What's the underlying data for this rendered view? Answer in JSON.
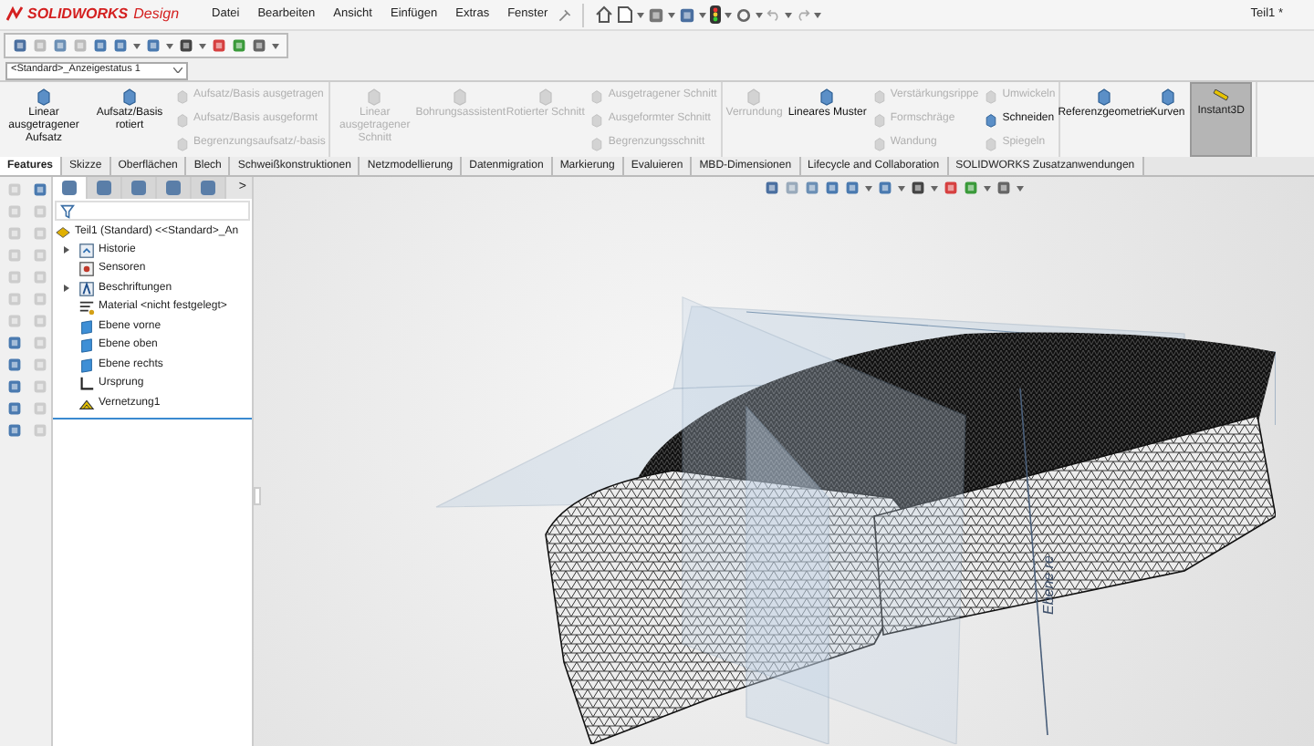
{
  "title_bar": {
    "brand": "SOLIDWORKS",
    "product": "Design",
    "menu": [
      {
        "label": "Datei"
      },
      {
        "label": "Bearbeiten"
      },
      {
        "label": "Ansicht"
      },
      {
        "label": "Einfügen"
      },
      {
        "label": "Extras"
      },
      {
        "label": "Fenster"
      }
    ],
    "document_title": "Teil1 *"
  },
  "configuration": {
    "value": "<Standard>_Anzeigestatus 1"
  },
  "ribbon": {
    "groups": [
      {
        "items": [
          {
            "kind": "large",
            "label": "Linear ausgetragener Aufsatz",
            "disabled": false
          },
          {
            "kind": "large",
            "label": "Aufsatz/Basis rotiert",
            "disabled": false
          },
          {
            "kind": "stack",
            "entries": [
              {
                "label": "Aufsatz/Basis ausgetragen",
                "disabled": true
              },
              {
                "label": "Aufsatz/Basis ausgeformt",
                "disabled": true
              },
              {
                "label": "Begrenzungsaufsatz/-basis",
                "disabled": true
              }
            ]
          }
        ]
      },
      {
        "items": [
          {
            "kind": "large",
            "label": "Linear ausgetragener Schnitt",
            "disabled": true
          },
          {
            "kind": "large",
            "label": "Bohrungsassistent",
            "disabled": true
          },
          {
            "kind": "large",
            "label": "Rotierter Schnitt",
            "disabled": true
          },
          {
            "kind": "stack",
            "entries": [
              {
                "label": "Ausgetragener Schnitt",
                "disabled": true
              },
              {
                "label": "Ausgeformter Schnitt",
                "disabled": true
              },
              {
                "label": "Begrenzungsschnitt",
                "disabled": true
              }
            ]
          }
        ]
      },
      {
        "items": [
          {
            "kind": "large",
            "label": "Verrundung",
            "disabled": true
          },
          {
            "kind": "large",
            "label": "Lineares Muster",
            "disabled": false
          },
          {
            "kind": "stack",
            "entries": [
              {
                "label": "Verstärkungsrippe",
                "disabled": true
              },
              {
                "label": "Formschräge",
                "disabled": true
              },
              {
                "label": "Wandung",
                "disabled": true
              }
            ]
          },
          {
            "kind": "stack",
            "entries": [
              {
                "label": "Umwickeln",
                "disabled": true
              },
              {
                "label": "Schneiden",
                "disabled": false
              },
              {
                "label": "Spiegeln",
                "disabled": true
              }
            ]
          }
        ]
      },
      {
        "items": [
          {
            "kind": "large",
            "label": "Referenzgeometrie",
            "disabled": false
          },
          {
            "kind": "large",
            "label": "Kurven",
            "disabled": false
          },
          {
            "kind": "toggle",
            "label": "Instant3D",
            "selected": true
          }
        ]
      }
    ]
  },
  "tabs": [
    {
      "label": "Features",
      "selected": true
    },
    {
      "label": "Skizze",
      "selected": false
    },
    {
      "label": "Oberflächen",
      "selected": false
    },
    {
      "label": "Blech",
      "selected": false
    },
    {
      "label": "Schweißkonstruktionen",
      "selected": false
    },
    {
      "label": "Netzmodellierung",
      "selected": false
    },
    {
      "label": "Datenmigration",
      "selected": false
    },
    {
      "label": "Markierung",
      "selected": false
    },
    {
      "label": "Evaluieren",
      "selected": false
    },
    {
      "label": "MBD-Dimensionen",
      "selected": false
    },
    {
      "label": "Lifecycle and Collaboration",
      "selected": false
    },
    {
      "label": "SOLIDWORKS Zusatzanwendungen",
      "selected": false
    }
  ],
  "feature_tree": {
    "panel_tabs": [
      {
        "selected": true
      },
      {
        "selected": false
      },
      {
        "selected": false
      },
      {
        "selected": false
      },
      {
        "selected": false
      }
    ],
    "more": ">",
    "root": "Teil1 (Standard) <<Standard>_An",
    "items": [
      {
        "kind": "history",
        "label": "Historie",
        "expandable": true
      },
      {
        "kind": "sensor",
        "label": "Sensoren",
        "expandable": false
      },
      {
        "kind": "annotation",
        "label": "Beschriftungen",
        "expandable": true
      },
      {
        "kind": "material",
        "label": "Material <nicht festgelegt>",
        "expandable": false
      },
      {
        "kind": "plane",
        "label": "Ebene vorne",
        "expandable": false
      },
      {
        "kind": "plane",
        "label": "Ebene oben",
        "expandable": false
      },
      {
        "kind": "plane",
        "label": "Ebene rechts",
        "expandable": false
      },
      {
        "kind": "origin",
        "label": "Ursprung",
        "expandable": false
      },
      {
        "kind": "mesh",
        "label": "Vernetzung1",
        "expandable": false
      }
    ]
  },
  "viewport": {
    "plane_label": "Ebene re"
  }
}
